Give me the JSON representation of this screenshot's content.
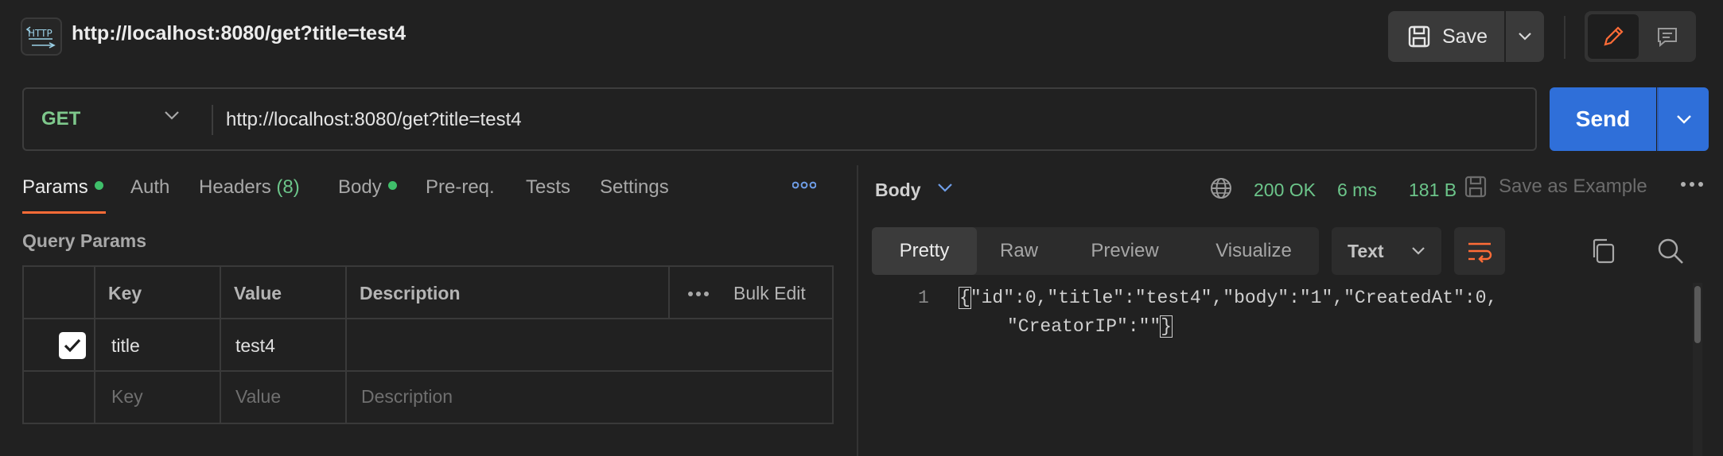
{
  "header": {
    "icon_label": "HTTP",
    "title": "http://localhost:8080/get?title=test4",
    "save_label": "Save"
  },
  "request": {
    "method": "GET",
    "url": "http://localhost:8080/get?title=test4",
    "send_label": "Send"
  },
  "tabs": {
    "params": "Params",
    "auth": "Auth",
    "headers": "Headers",
    "headers_count": "(8)",
    "body": "Body",
    "prereq": "Pre-req.",
    "tests": "Tests",
    "settings": "Settings"
  },
  "query_params": {
    "title": "Query Params",
    "columns": {
      "key": "Key",
      "value": "Value",
      "description": "Description",
      "bulk_edit": "Bulk Edit"
    },
    "rows": [
      {
        "checked": true,
        "key": "title",
        "value": "test4",
        "description": ""
      }
    ],
    "placeholder": {
      "key": "Key",
      "value": "Value",
      "description": "Description"
    }
  },
  "response": {
    "body_label": "Body",
    "status": "200 OK",
    "time": "6 ms",
    "size": "181 B",
    "save_example": "Save as Example",
    "view_tabs": [
      "Pretty",
      "Raw",
      "Preview",
      "Visualize"
    ],
    "format": "Text",
    "line_number": "1",
    "line1_open": "{",
    "line1_text": "\"id\":0,\"title\":\"test4\",\"body\":\"1\",\"CreatedAt\":0,",
    "line2_text": "\"CreatorIP\":\"\"",
    "line2_close": "}"
  },
  "colors": {
    "accent": "#ff6c37",
    "send": "#2f6fd9",
    "success": "#6cc58a",
    "method_get": "#7ec88c"
  }
}
